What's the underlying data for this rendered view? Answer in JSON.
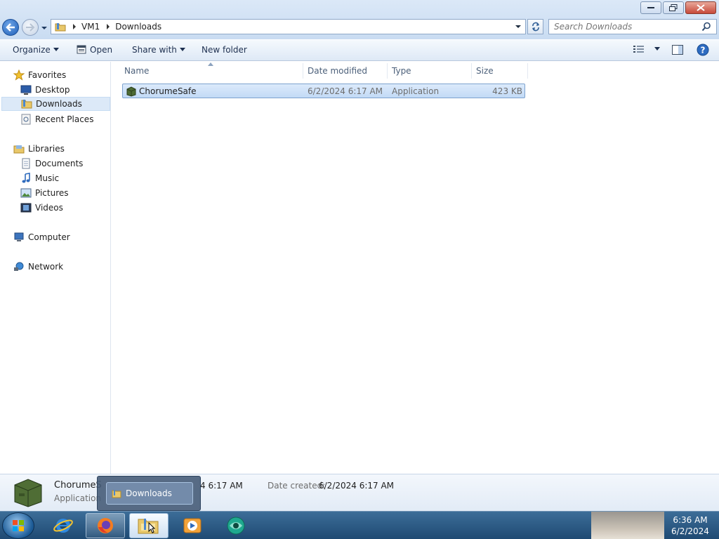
{
  "window": {
    "breadcrumb": [
      "VM1",
      "Downloads"
    ],
    "search_placeholder": "Search Downloads"
  },
  "toolbar": {
    "organize": "Organize",
    "open": "Open",
    "share_with": "Share with",
    "new_folder": "New folder"
  },
  "nav": {
    "favorites": "Favorites",
    "desktop": "Desktop",
    "downloads": "Downloads",
    "recent_places": "Recent Places",
    "libraries": "Libraries",
    "documents": "Documents",
    "music": "Music",
    "pictures": "Pictures",
    "videos": "Videos",
    "computer": "Computer",
    "network": "Network"
  },
  "columns": {
    "name": "Name",
    "date_modified": "Date modified",
    "type": "Type",
    "size": "Size"
  },
  "files": [
    {
      "name": "ChorumeSafe",
      "date_modified": "6/2/2024 6:17 AM",
      "type": "Application",
      "size": "423 KB"
    }
  ],
  "details": {
    "name": "ChorumeS",
    "type": "Application",
    "modified_fragment": "4 6:17 AM",
    "date_created_label": "Date created:",
    "date_created_value": "6/2/2024 6:17 AM"
  },
  "thumbnail": {
    "label": "Downloads"
  },
  "taskbar": {
    "time": "6:36 AM",
    "date": "6/2/2024"
  },
  "colors": {
    "selection": "#cce0f7",
    "taskbar": "#2a5a85",
    "link": "#1e3050"
  }
}
